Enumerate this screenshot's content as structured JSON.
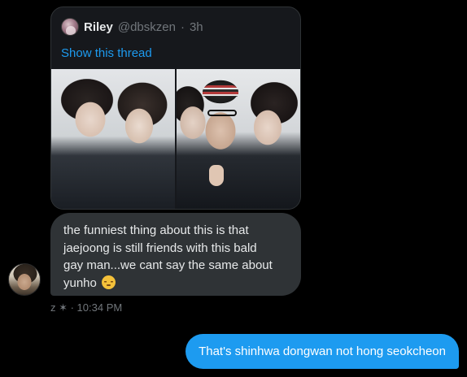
{
  "quoted_tweet": {
    "author_name": "Riley",
    "author_handle": "@dbskzen",
    "separator": "·",
    "time_ago": "3h",
    "show_thread_label": "Show this thread"
  },
  "received_message": {
    "lines": [
      "the funniest thing about this is that",
      "jaejoong is still friends with this bald",
      "gay man...we cant say the same about",
      "yunho"
    ],
    "emoji": "pensive-face-emoji",
    "meta": "z ✶ · 10:34 PM"
  },
  "sent_message": {
    "text": "That's shinhwa dongwan not hong seokcheon"
  },
  "colors": {
    "background": "#000000",
    "received_bubble": "#2f3336",
    "sent_bubble": "#1d9bf0",
    "link": "#1d9bf0",
    "secondary_text": "#71767b",
    "primary_text": "#e7e9ea"
  }
}
